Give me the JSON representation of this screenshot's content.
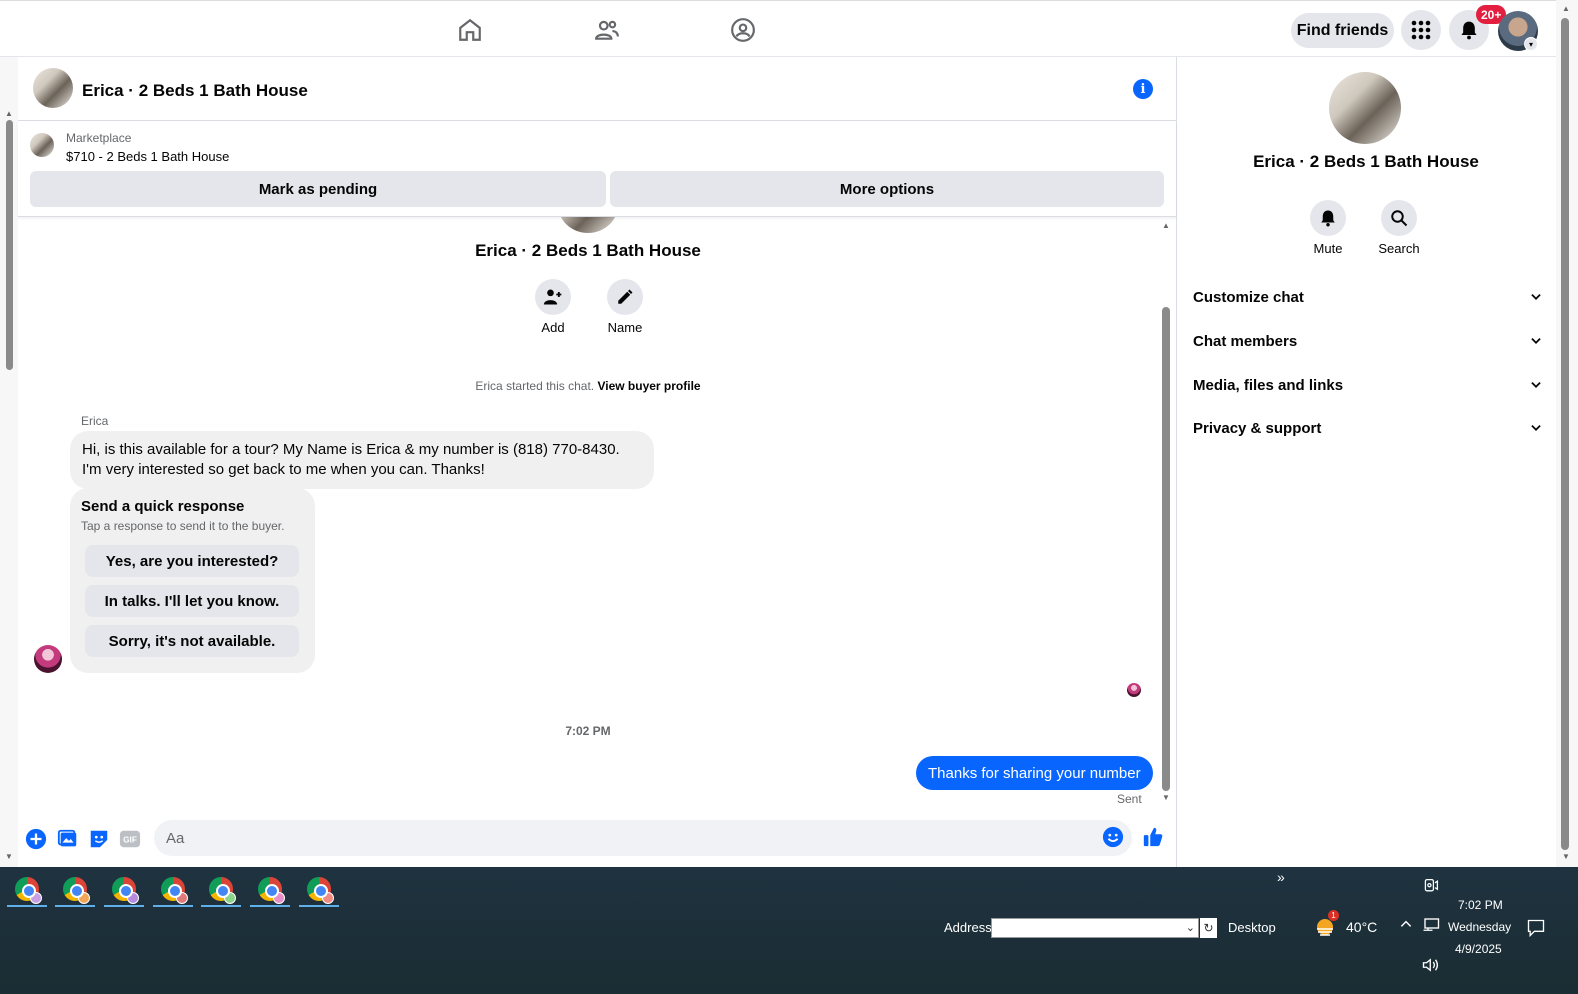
{
  "topnav": {
    "find_friends": "Find friends",
    "notification_count": "20+"
  },
  "chat": {
    "title": "Erica · 2 Beds 1 Bath House",
    "marketplace_label": "Marketplace",
    "listing": "$710 - 2 Beds 1 Bath House",
    "mark_pending": "Mark as pending",
    "more_options": "More options",
    "intro_title": "Erica · 2 Beds 1 Bath House",
    "intro_add": "Add",
    "intro_name": "Name",
    "started_text": "Erica started this chat.",
    "view_buyer_profile": "View buyer profile",
    "sender_name": "Erica",
    "buyer_message": "Hi, is this available for a tour? My Name is Erica & my number is (818) 770-8430. I'm very interested so get back to me when you can. Thanks!",
    "quick_title": "Send a quick response",
    "quick_subtitle": "Tap a response to send it to the buyer.",
    "quick_options": [
      "Yes, are you interested?",
      "In talks. I'll let you know.",
      "Sorry, it's not available."
    ],
    "time": "7:02 PM",
    "my_message": "Thanks for sharing your number",
    "status": "Sent",
    "input_placeholder": "Aa"
  },
  "right_panel": {
    "title": "Erica · 2 Beds 1 Bath House",
    "mute": "Mute",
    "search": "Search",
    "sections": [
      "Customize chat",
      "Chat members",
      "Media, files and links",
      "Privacy & support"
    ]
  },
  "taskbar": {
    "address_label": "Address",
    "desktop_label": "Desktop",
    "temperature": "40°C",
    "weather_alert": "1",
    "time": "7:02 PM",
    "day": "Wednesday",
    "date": "4/9/2025"
  },
  "colors": {
    "accent": "#0866ff",
    "badge": "#e41e3f",
    "taskbar": "#1f3240"
  }
}
